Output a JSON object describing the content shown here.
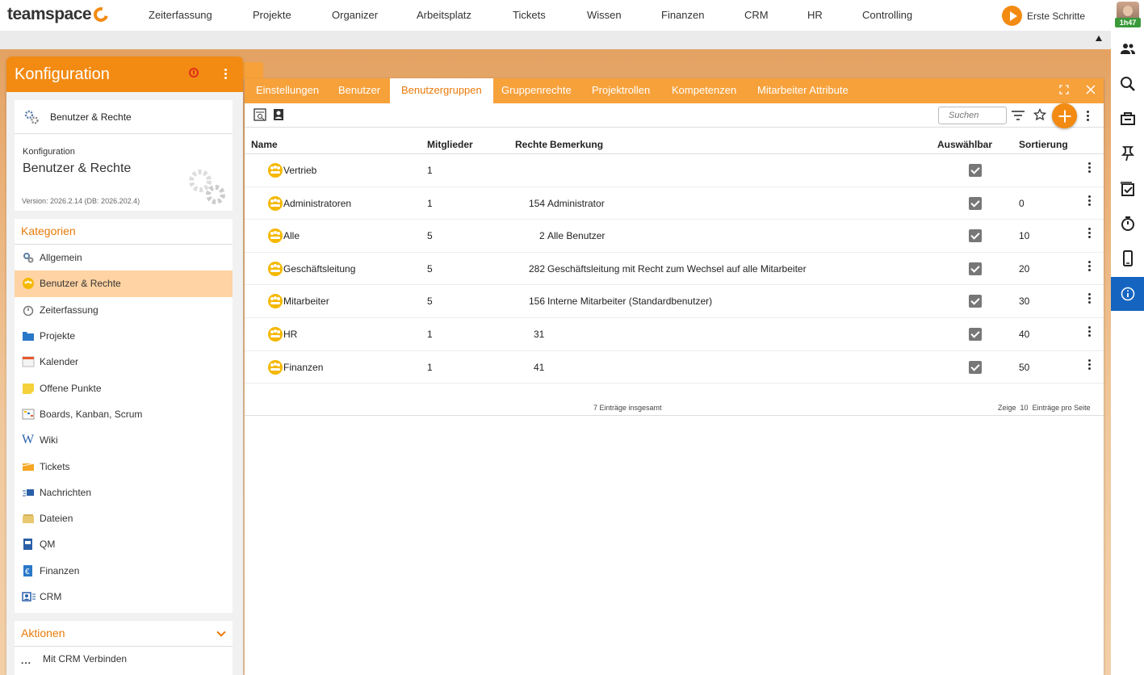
{
  "brand": {
    "logo_text": "teamspace"
  },
  "nav": {
    "items": [
      "Zeiterfassung",
      "Projekte",
      "Organizer",
      "Arbeitsplatz",
      "Tickets",
      "Wissen",
      "Finanzen",
      "CRM",
      "HR",
      "Controlling"
    ],
    "first_steps": "Erste Schritte"
  },
  "rail": {
    "timer": "1h47",
    "icons": [
      "users-icon",
      "search-icon",
      "inbox-icon",
      "pin-icon",
      "tasks-icon",
      "stopwatch-icon",
      "mobile-icon",
      "info-icon"
    ]
  },
  "config_panel": {
    "title": "Konfiguration",
    "breadcrumb": "Benutzer & Rechte",
    "section_small": "Konfiguration",
    "section_big": "Benutzer & Rechte",
    "version": "Version: 2026.2.14 (DB: 2026.202.4)",
    "categories_title": "Kategorien",
    "categories": [
      "Allgemein",
      "Benutzer & Rechte",
      "Zeiterfassung",
      "Projekte",
      "Kalender",
      "Offene Punkte",
      "Boards, Kanban, Scrum",
      "Wiki",
      "Tickets",
      "Nachrichten",
      "Dateien",
      "QM",
      "Finanzen",
      "CRM"
    ],
    "selected_category": "Benutzer & Rechte",
    "actions_title": "Aktionen",
    "action_item": "Mit CRM Verbinden",
    "action_dots": "..."
  },
  "window": {
    "tabs": [
      "Einstellungen",
      "Benutzer",
      "Benutzergruppen",
      "Gruppenrechte",
      "Projektrollen",
      "Kompetenzen",
      "Mitarbeiter Attribute"
    ],
    "active_tab": "Benutzergruppen",
    "search_placeholder": "Suchen",
    "columns": {
      "name": "Name",
      "members": "Mitglieder",
      "rights": "Rechte",
      "remark": "Bemerkung",
      "selectable": "Auswählbar",
      "sort": "Sortierung"
    },
    "rows": [
      {
        "name": "Vertrieb",
        "members": "1",
        "rights": "",
        "remark": "",
        "selectable": true,
        "sort": ""
      },
      {
        "name": "Administratoren",
        "members": "1",
        "rights": "154",
        "remark": "Administrator",
        "selectable": true,
        "sort": "0"
      },
      {
        "name": "Alle",
        "members": "5",
        "rights": "2",
        "remark": "Alle Benutzer",
        "selectable": true,
        "sort": "10"
      },
      {
        "name": "Geschäftsleitung",
        "members": "5",
        "rights": "282",
        "remark": "Geschäftsleitung mit Recht zum Wechsel auf alle Mitarbeiter",
        "selectable": true,
        "sort": "20"
      },
      {
        "name": "Mitarbeiter",
        "members": "5",
        "rights": "156",
        "remark": "Interne Mitarbeiter (Standardbenutzer)",
        "selectable": true,
        "sort": "30"
      },
      {
        "name": "HR",
        "members": "1",
        "rights": "31",
        "remark": "",
        "selectable": true,
        "sort": "40"
      },
      {
        "name": "Finanzen",
        "members": "1",
        "rights": "41",
        "remark": "",
        "selectable": true,
        "sort": "50"
      }
    ],
    "footer_total": "7 Einträge insgesamt",
    "footer_show": "Zeige",
    "footer_count": "10",
    "footer_per_page": "Einträge pro Seite"
  },
  "colors": {
    "accent": "#f38a12",
    "tab_bar": "#f7a13b",
    "selected": "#ffd3a3",
    "info_active": "#1565c0"
  }
}
